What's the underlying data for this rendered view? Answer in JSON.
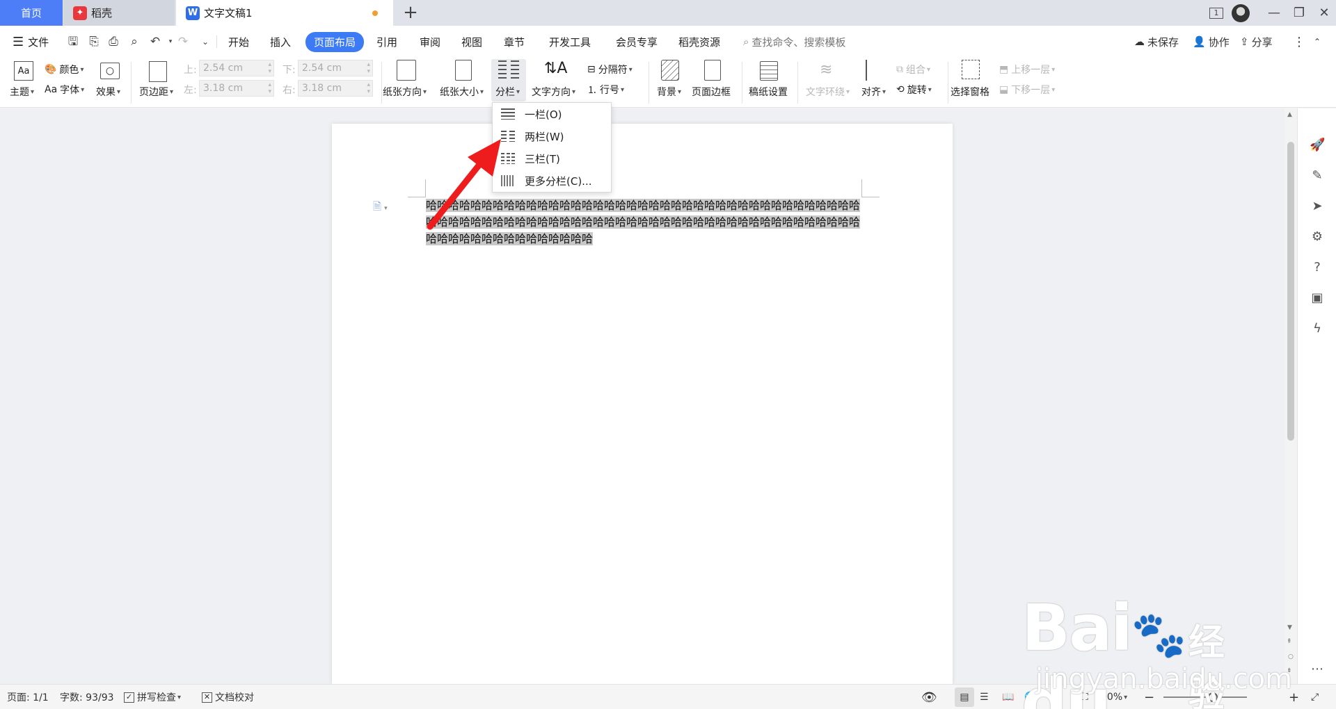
{
  "tabs": {
    "home": "首页",
    "shell": "稻壳",
    "document": "文字文稿1",
    "new_tab": "+"
  },
  "window": {
    "tab_count": "1"
  },
  "menu": {
    "file": "文件",
    "items": [
      "开始",
      "插入",
      "页面布局",
      "引用",
      "审阅",
      "视图",
      "章节",
      "开发工具",
      "会员专享",
      "稻壳资源"
    ],
    "active": "页面布局",
    "search_placeholder": "查找命令、搜索模板",
    "unsaved": "未保存",
    "collab": "协作",
    "share": "分享"
  },
  "ribbon": {
    "theme": "主题",
    "color": "颜色",
    "font": "字体",
    "effect": "效果",
    "margins": "页边距",
    "top_label": "上:",
    "top_value": "2.54 cm",
    "bottom_label": "下:",
    "bottom_value": "2.54 cm",
    "left_label": "左:",
    "left_value": "3.18 cm",
    "right_label": "右:",
    "right_value": "3.18 cm",
    "orientation": "纸张方向",
    "size": "纸张大小",
    "columns": "分栏",
    "text_direction": "文字方向",
    "breaks": "分隔符",
    "line_numbers": "行号",
    "background": "背景",
    "page_border": "页面边框",
    "manuscript": "稿纸设置",
    "text_wrap": "文字环绕",
    "align": "对齐",
    "group": "组合",
    "rotate": "旋转",
    "selection_pane": "选择窗格",
    "bring_forward": "上移一层",
    "send_backward": "下移一层"
  },
  "columns_menu": {
    "items": [
      "一栏(O)",
      "两栏(W)",
      "三栏(T)",
      "更多分栏(C)..."
    ]
  },
  "document": {
    "line1": "哈哈哈哈哈哈哈哈哈哈哈哈哈哈哈哈哈哈哈哈哈哈哈哈哈哈哈哈哈哈哈哈哈哈哈哈哈哈哈",
    "line2": "哈哈哈哈哈哈哈哈哈哈哈哈哈哈哈哈哈哈哈哈哈哈哈哈哈哈哈哈哈哈哈哈哈哈哈哈哈哈哈",
    "line3": "哈哈哈哈哈哈哈哈哈哈哈哈哈哈哈"
  },
  "status": {
    "page": "页面: 1/1",
    "words": "字数: 93/93",
    "spell": "拼写检查",
    "proofread": "文档校对",
    "zoom": "90%"
  },
  "watermark": {
    "brand": "Bai",
    "brand2": "du",
    "cn": "经验",
    "url": "jingyan.baidu.com"
  },
  "colors": {
    "accent": "#3d7bf6",
    "home_tab": "#4d7ef7",
    "arrow": "#ee1c1c",
    "selection": "#c8c8c8"
  },
  "icons": [
    "menu-icon",
    "save-icon",
    "print-icon",
    "undo-icon",
    "redo-icon",
    "search-icon",
    "cloud-icon",
    "user-icon",
    "share-icon",
    "columns-icon",
    "eye-icon",
    "pen-icon",
    "rocket-icon"
  ]
}
